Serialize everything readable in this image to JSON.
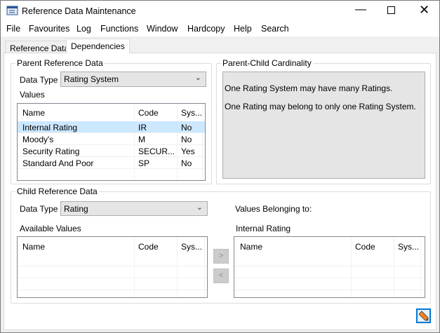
{
  "window": {
    "title": "Reference Data Maintenance",
    "icon": "form-window-icon"
  },
  "menu": [
    "File",
    "Favourites",
    "Log",
    "Functions",
    "Window",
    "Hardcopy",
    "Help",
    "Search"
  ],
  "tabs": [
    {
      "label": "Reference Data",
      "selected": false
    },
    {
      "label": "Dependencies",
      "selected": true
    }
  ],
  "parent": {
    "group_label": "Parent Reference Data",
    "data_type_label": "Data Type",
    "data_type_value": "Rating System",
    "values_label": "Values",
    "columns": [
      "Name",
      "Code",
      "Sys..."
    ],
    "rows": [
      [
        "Internal Rating",
        "IR",
        "No"
      ],
      [
        "Moody's",
        "M",
        "No"
      ],
      [
        "Security Rating",
        "SECUR...",
        "Yes"
      ],
      [
        "Standard And Poor",
        "SP",
        "No"
      ]
    ],
    "selected_row": 0
  },
  "cardinality": {
    "group_label": "Parent-Child Cardinality",
    "lines": [
      "One Rating System may have many Ratings.",
      "One Rating may belong to only one Rating System."
    ]
  },
  "child": {
    "group_label": "Child Reference Data",
    "data_type_label": "Data Type",
    "data_type_value": "Rating",
    "belonging_label": "Values Belonging to:",
    "available_label": "Available Values",
    "selected_parent": "Internal Rating",
    "columns": [
      "Name",
      "Code",
      "Sys..."
    ],
    "add_button": ">",
    "remove_button": "<"
  },
  "colors": {
    "selection": "#cce8ff",
    "accent": "#0078d7"
  }
}
